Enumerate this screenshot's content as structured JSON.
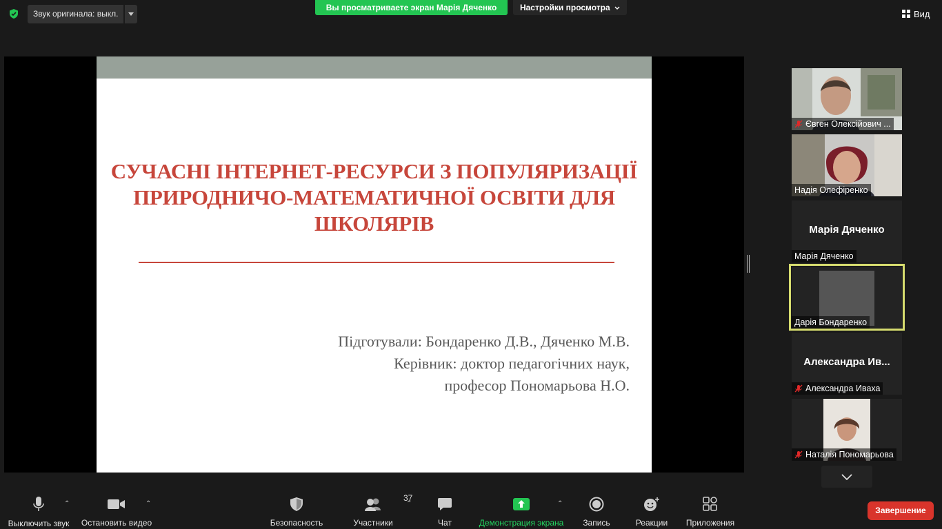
{
  "topbar": {
    "original_sound": "Звук оригинала: выкл.",
    "share_banner": "Вы просматриваете экран Марія Дяченко",
    "view_settings": "Настройки просмотра",
    "view": "Вид"
  },
  "slide": {
    "title_lines": [
      "СУЧАСНІ ІНТЕРНЕТ-РЕСУРСИ З ПОПУЛЯРИЗАЦІЇ",
      "ПРИРОДНИЧО-МАТЕМАТИЧНОЇ ОСВІТИ ДЛЯ",
      "ШКОЛЯРІВ"
    ],
    "credits": [
      "Підготували: Бондаренко Д.В., Дяченко М.В.",
      "Керівник: доктор педагогічних наук,",
      "професор Пономарьова Н.О."
    ]
  },
  "gallery": {
    "participants": [
      {
        "name": "Євген Олексійович ...",
        "muted": true,
        "display": "video"
      },
      {
        "name": "Надія Олефіренко",
        "muted": false,
        "display": "video"
      },
      {
        "name": "Марія Дяченко",
        "big_name": "Марія Дяченко",
        "muted": false,
        "display": "name"
      },
      {
        "name": "Дарія Бондаренко",
        "muted": false,
        "display": "video",
        "active_speaker": true
      },
      {
        "name": "Александра Иваха",
        "big_name": "Александра  Ив...",
        "muted": true,
        "display": "name"
      },
      {
        "name": "Наталія Пономарьова",
        "muted": true,
        "display": "video"
      }
    ]
  },
  "toolbar": {
    "mute": "Выключить звук",
    "video": "Остановить видео",
    "security": "Безопасность",
    "participants": "Участники",
    "participants_count": "37",
    "chat": "Чат",
    "share": "Демонстрация экрана",
    "record": "Запись",
    "reactions": "Реакции",
    "apps": "Приложения",
    "end": "Завершение"
  },
  "colors": {
    "share_green": "#23c552",
    "slide_title": "#c7463b",
    "end_red": "#d9342b",
    "active_border": "#d7dd6f"
  }
}
